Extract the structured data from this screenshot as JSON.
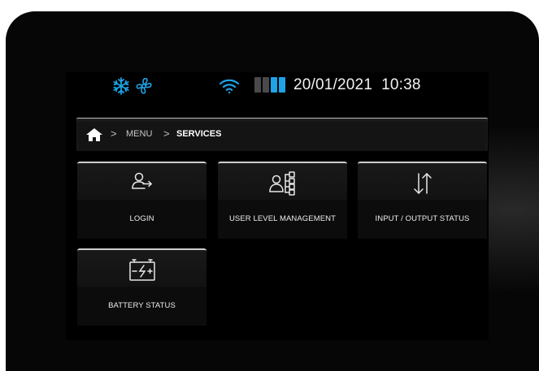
{
  "status_bar": {
    "icons": [
      "snowflake-icon",
      "fan-icon",
      "wifi-icon"
    ],
    "battery_segments": [
      "#4a4a4a",
      "#4a4a4a",
      "#1ea3e6",
      "#1ea3e6"
    ],
    "accent_color": "#1ea3e6",
    "date": "20/01/2021",
    "time": "10:38"
  },
  "breadcrumb": {
    "home_icon": "home-icon",
    "items": [
      "MENU",
      "SERVICES"
    ]
  },
  "tiles": [
    {
      "label": "LOGIN",
      "icon": "login-icon"
    },
    {
      "label": "USER LEVEL MANAGEMENT",
      "icon": "user-hierarchy-icon"
    },
    {
      "label": "INPUT / OUTPUT STATUS",
      "icon": "input-output-arrows-icon"
    },
    {
      "label": "BATTERY STATUS",
      "icon": "battery-status-icon"
    }
  ]
}
